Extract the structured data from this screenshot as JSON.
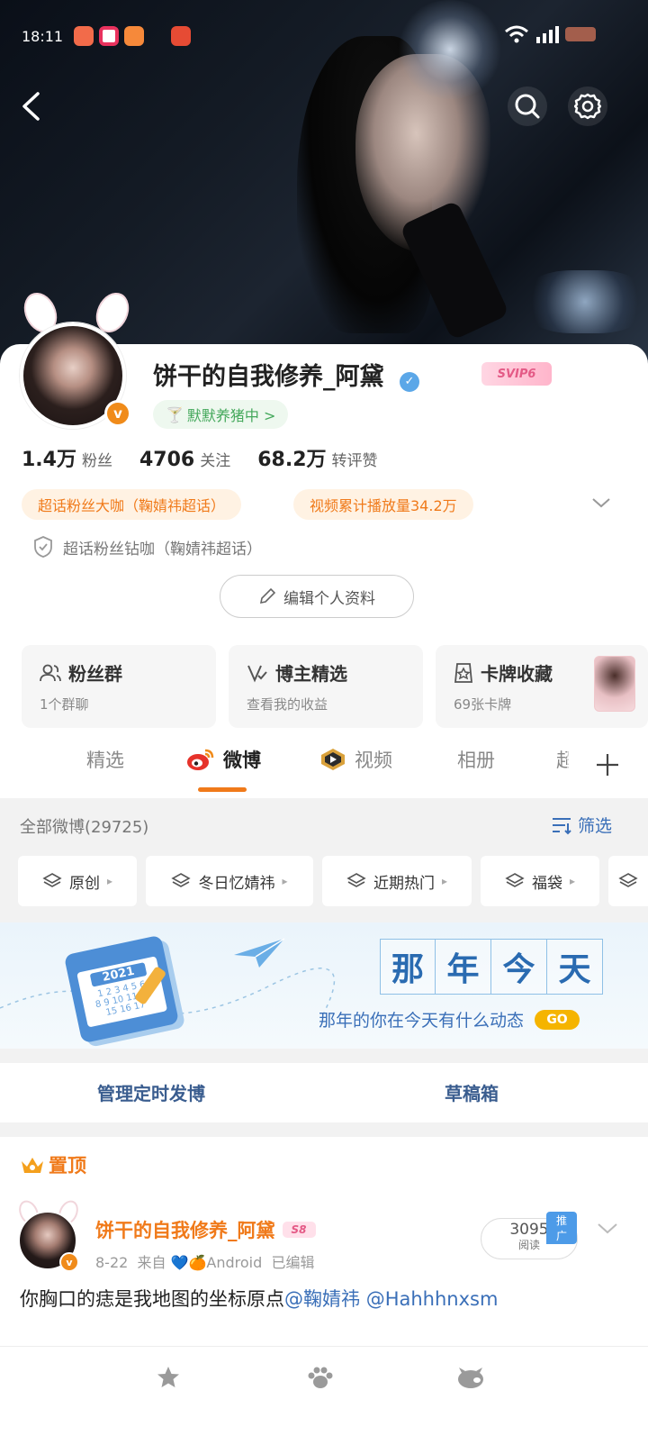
{
  "status_bar": {
    "time": "18:11"
  },
  "header": {
    "back_icon": "back-arrow-icon",
    "search_icon": "search-icon",
    "settings_icon": "gear-icon"
  },
  "profile": {
    "name": "饼干的自我修养_阿黛",
    "vip_badge": "SVIP6",
    "tag": "默默养猪中 >",
    "stats": [
      {
        "value": "1.4万",
        "label": "粉丝"
      },
      {
        "value": "4706",
        "label": "关注"
      },
      {
        "value": "68.2万",
        "label": "转评赞"
      }
    ],
    "honors": [
      "超话粉丝大咖（鞠婧祎超话）",
      "视频累计播放量34.2万"
    ],
    "honor_line": "超话粉丝钻咖（鞠婧祎超话）",
    "edit_button": "编辑个人资料"
  },
  "tiles": [
    {
      "title": "粉丝群",
      "subtitle": "1个群聊",
      "icon": "group-icon"
    },
    {
      "title": "博主精选",
      "subtitle": "查看我的收益",
      "icon": "v-select-icon"
    },
    {
      "title": "卡牌收藏",
      "subtitle": "69张卡牌",
      "icon": "card-icon"
    }
  ],
  "tabs": [
    "精选",
    "微博",
    "视频",
    "相册",
    "超"
  ],
  "active_tab": "微博",
  "filter_bar": {
    "count_label": "全部微博(29725)",
    "filter_label": "筛选"
  },
  "chips": [
    "原创",
    "冬日忆婧祎",
    "近期热门",
    "福袋"
  ],
  "today_banner": {
    "chars": [
      "那",
      "年",
      "今",
      "天"
    ],
    "subtitle": "那年的你在今天有什么动态",
    "go": "GO",
    "calendar_year": "2021"
  },
  "manage": {
    "scheduled": "管理定时发博",
    "drafts": "草稿箱"
  },
  "pinned": {
    "label": "置顶"
  },
  "post": {
    "author": "饼干的自我修养_阿黛",
    "level_badge": "S8",
    "meta": "8-22  来自 💙🍊Android  已编辑",
    "reads": "3095",
    "reads_label": "阅读",
    "promo": "推广",
    "text_plain": "你胸口的痣是我地图的坐标原点",
    "mention1": "@鞠婧祎",
    "mention2": "@Hahhhnxsm"
  },
  "colors": {
    "accent": "#f07a1a",
    "link": "#3a5d8f",
    "blue_badge": "#5ba7e8"
  }
}
